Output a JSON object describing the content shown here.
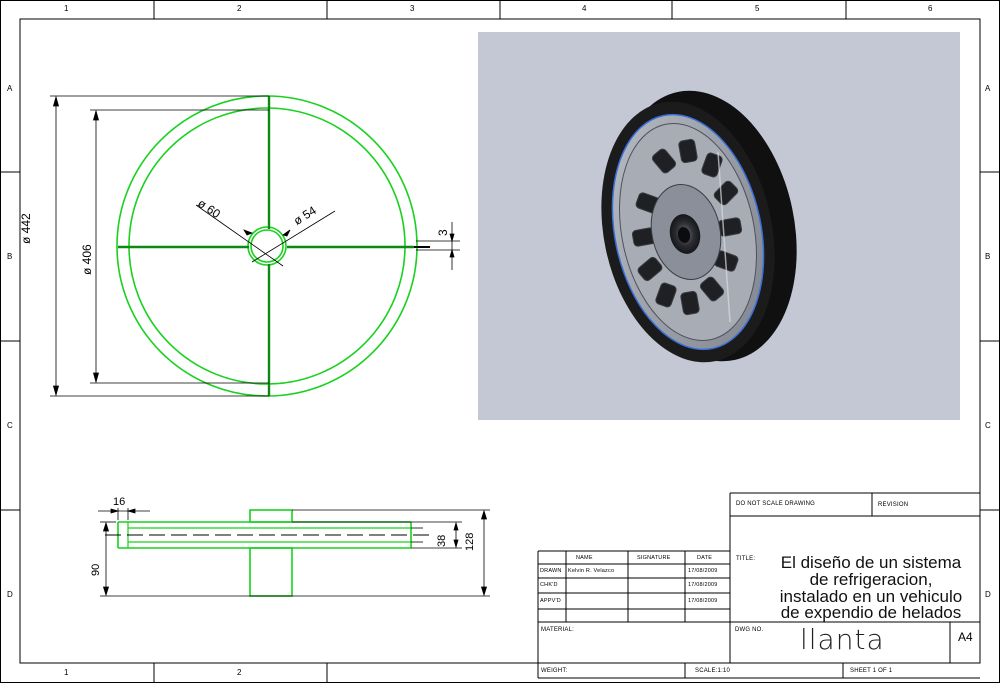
{
  "zones": {
    "columns": [
      "1",
      "2",
      "3",
      "4",
      "5",
      "6"
    ],
    "bottom_columns": [
      "1",
      "2"
    ],
    "rows": [
      "A",
      "B",
      "C",
      "D"
    ]
  },
  "front_view": {
    "dims": {
      "d442": "ø 442",
      "d406": "ø 406",
      "d60": "ø 60",
      "d54": "ø 54",
      "d3": "3"
    }
  },
  "side_view": {
    "dims": {
      "d16": "16",
      "d90": "90",
      "d38": "38",
      "d128": "128"
    }
  },
  "colors": {
    "geometry": "#19d11e",
    "dimension": "#000000",
    "render_bg": "#c3c8d4",
    "tire": "#151515",
    "rim_accent": "#3a6fd8"
  },
  "title_block": {
    "do_not_scale": "DO NOT SCALE DRAWING",
    "revision": "REVISION",
    "headers": {
      "name": "NAME",
      "signature": "SIGNATURE",
      "date": "DATE"
    },
    "rows": [
      {
        "role": "DRAWN",
        "name": "Kelvin R. Velazco",
        "date": "17/08/2009"
      },
      {
        "role": "CHK'D",
        "name": "",
        "date": "17/08/2009"
      },
      {
        "role": "APPV'D",
        "name": "",
        "date": "17/08/2009"
      }
    ],
    "title_label": "TITLE:",
    "title_lines": [
      "El diseño de un sistema",
      "de refrigeracion,",
      "instalado en un vehiculo",
      "de expendio de helados"
    ],
    "material_label": "MATERIAL:",
    "dwg_label": "DWG NO.",
    "dwg_name": "llanta",
    "sheet_size": "A4",
    "weight_label": "WEIGHT:",
    "scale": "SCALE:1:10",
    "sheet": "SHEET 1 OF 1"
  }
}
